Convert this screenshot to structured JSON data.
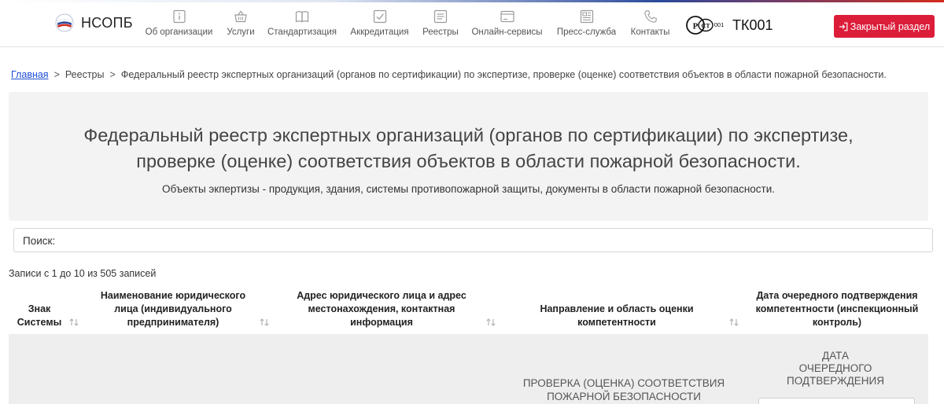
{
  "header": {
    "logo_text": "НСОПБ",
    "nav": [
      {
        "label": "Об организации",
        "icon": "info-icon"
      },
      {
        "label": "Услуги",
        "icon": "basket-icon"
      },
      {
        "label": "Стандартизация",
        "icon": "book-icon"
      },
      {
        "label": "Аккредитация",
        "icon": "check-icon"
      },
      {
        "label": "Реестры",
        "icon": "list-icon"
      },
      {
        "label": "Онлайн-сервисы",
        "icon": "window-icon"
      },
      {
        "label": "Пресс-служба",
        "icon": "newspaper-icon"
      },
      {
        "label": "Контакты",
        "icon": "phone-icon"
      }
    ],
    "tk_emblem": "РСТ 001",
    "tk_text": "ТК001",
    "closed_button": "Закрытый раздел",
    "accent": "#dc1d3a"
  },
  "breadcrumb": {
    "home": "Главная",
    "separator": ">",
    "registries": "Реестры",
    "current": "Федеральный реестр экспертных организаций (органов по сертификации) по экспертизе, проверке (оценке) соответствия объектов в области пожарной безопасности."
  },
  "hero": {
    "title_line1": "Федеральный реестр экспертных организаций (органов по сертификации) по экспертизе,",
    "title_line2": "проверке (оценке) соответствия объектов в области пожарной безопасности.",
    "subtitle": "Объекты экпертизы - продукция, здания, системы противопожарной защиты, документы в области пожарной безопасности."
  },
  "search": {
    "label": "Поиск:"
  },
  "records_info": "Записи с 1 до 10 из 505 записей",
  "table": {
    "columns": [
      {
        "line1": "Знак",
        "line2": "Системы",
        "line3": ""
      },
      {
        "line1": "Наименование юридического",
        "line2": "лица (индивидуального",
        "line3": "предпринимателя)"
      },
      {
        "line1": "Адрес юридического лица и адрес",
        "line2": "местонахождения, контактная",
        "line3": "информация"
      },
      {
        "line1": "Направление и область оценки",
        "line2": "компетентности",
        "line3": ""
      },
      {
        "line1": "Дата очередного подтверждения",
        "line2": "компетентности (инспекционный",
        "line3": "контроль)"
      }
    ],
    "filter_row": {
      "direction_line1": "Проверка (оценка) соответствия",
      "direction_line2": "пожарной безопасности",
      "date_line1": "Дата",
      "date_line2": "очередного",
      "date_line3": "подтверждения"
    }
  }
}
